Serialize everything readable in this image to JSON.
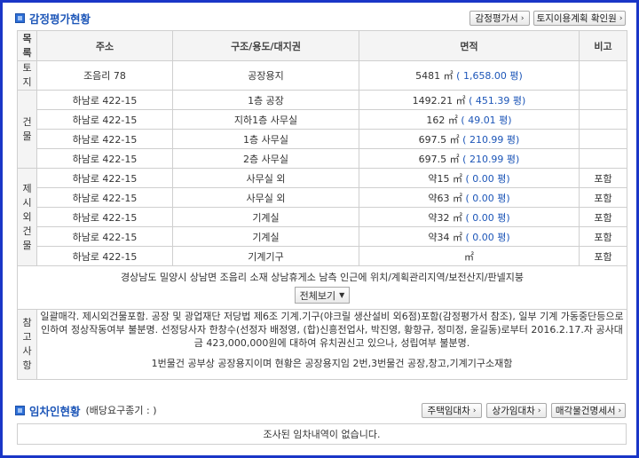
{
  "appraisal": {
    "title": "감정평가현황",
    "buttons": {
      "report": "감정평가서",
      "land_plan": "토지이용계획 확인원"
    },
    "headers": {
      "category": [
        "목",
        "록"
      ],
      "address": "주소",
      "structure": "구조/용도/대지권",
      "area": "면적",
      "note": "비고"
    },
    "groups": {
      "land": [
        "토",
        "지"
      ],
      "building": [
        "건",
        "물"
      ],
      "excluded": [
        "제",
        "시",
        "외",
        "건",
        "물"
      ]
    },
    "land_rows": [
      {
        "address": "조음리 78",
        "structure": "공장용지",
        "area": "5481 ㎡",
        "pyeong": "( 1,658.00 평)",
        "note": ""
      }
    ],
    "building_rows": [
      {
        "address": "하남로 422-15",
        "structure": "1층 공장",
        "area": "1492.21 ㎡",
        "pyeong": "( 451.39 평)",
        "note": ""
      },
      {
        "address": "하남로 422-15",
        "structure": "지하1층 사무실",
        "area": "162 ㎡",
        "pyeong": "( 49.01 평)",
        "note": ""
      },
      {
        "address": "하남로 422-15",
        "structure": "1층 사무실",
        "area": "697.5 ㎡",
        "pyeong": "( 210.99 평)",
        "note": ""
      },
      {
        "address": "하남로 422-15",
        "structure": "2층 사무실",
        "area": "697.5 ㎡",
        "pyeong": "( 210.99 평)",
        "note": ""
      }
    ],
    "excluded_rows": [
      {
        "address": "하남로 422-15",
        "structure": "사무실 외",
        "area": "약15 ㎡",
        "pyeong": "( 0.00 평)",
        "note": "포함"
      },
      {
        "address": "하남로 422-15",
        "structure": "사무실 외",
        "area": "약63 ㎡",
        "pyeong": "( 0.00 평)",
        "note": "포함"
      },
      {
        "address": "하남로 422-15",
        "structure": "기계실",
        "area": "약32 ㎡",
        "pyeong": "( 0.00 평)",
        "note": "포함"
      },
      {
        "address": "하남로 422-15",
        "structure": "기계실",
        "area": "약34 ㎡",
        "pyeong": "( 0.00 평)",
        "note": "포함"
      },
      {
        "address": "하남로 422-15",
        "structure": "기계기구",
        "area": "㎡",
        "pyeong": "",
        "note": "포함"
      }
    ],
    "location_text": "경상남도 밀양시 상남면 조음리 소재 상남휴게소 남측 인근에 위치/계획관리지역/보전산지/판넬지붕",
    "view_all": "전체보기",
    "notes_label": [
      "참",
      "고",
      "사",
      "항"
    ],
    "notes_text_1": "일괄매각. 제시외건물포함. 공장 및 광업재단 저당법 제6조 기계.기구(야크릴 생산설비 외6점)포함(감정평가서 참조), 일부 기계 가동중단등으로 인하여 정상작동여부 불분명. 선정당사자 한창수(선정자 배정영, (합)신흥전업사, 박진영, 황향규, 정미정, 윤길동)로부터 2016.2.17.자 공사대금 423,000,000원에 대하여 유치권신고 있으나, 성립여부 불분명.",
    "notes_text_2": "1번물건 공부상 공장용지이며 현황은 공장용지임 2번,3번물건 공장,창고,기계기구소재함"
  },
  "tenant": {
    "title": "임차인현황",
    "subtitle": "(배당요구종기 : )",
    "buttons": {
      "house": "주택임대차",
      "store": "상가임대차",
      "sale_detail": "매각물건명세서"
    },
    "empty_text": "조사된 임차내역이 없습니다."
  }
}
